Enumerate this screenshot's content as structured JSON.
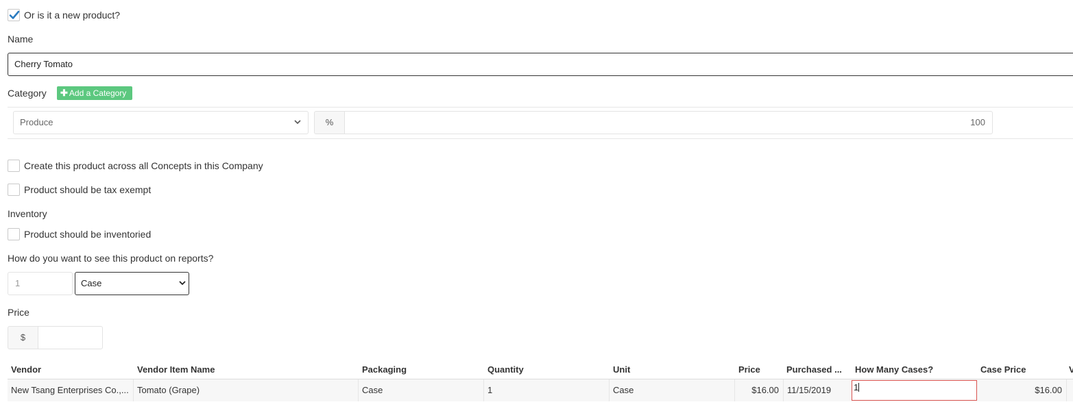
{
  "new_product": {
    "label": "Or is it a new product?",
    "checked": true
  },
  "name": {
    "label": "Name",
    "value": "Cherry Tomato"
  },
  "category": {
    "label": "Category",
    "add_button": "Add a Category",
    "selected": "Produce",
    "percent_addon": "%",
    "percent_value": "100"
  },
  "options": {
    "all_concepts": "Create this product across all Concepts in this Company",
    "tax_exempt": "Product should be tax exempt"
  },
  "inventory": {
    "label": "Inventory",
    "inventoried": "Product should be inventoried"
  },
  "reports": {
    "label": "How do you want to see this product on reports?",
    "quantity_placeholder": "1",
    "unit_selected": "Case"
  },
  "price": {
    "label": "Price",
    "addon": "$",
    "value": ""
  },
  "vendors_table": {
    "headers": [
      "Vendor",
      "Vendor Item Name",
      "Packaging",
      "Quantity",
      "Unit",
      "Price",
      "Purchased ...",
      "How Many Cases?",
      "Case Price",
      "V"
    ],
    "rows": [
      {
        "vendor": "New Tsang Enterprises Co.,...",
        "item_name": "Tomato (Grape)",
        "packaging": "Case",
        "quantity": "1",
        "unit": "Case",
        "price": "$16.00",
        "purchased": "11/15/2019",
        "cases": "1",
        "case_price": "$16.00"
      }
    ]
  }
}
